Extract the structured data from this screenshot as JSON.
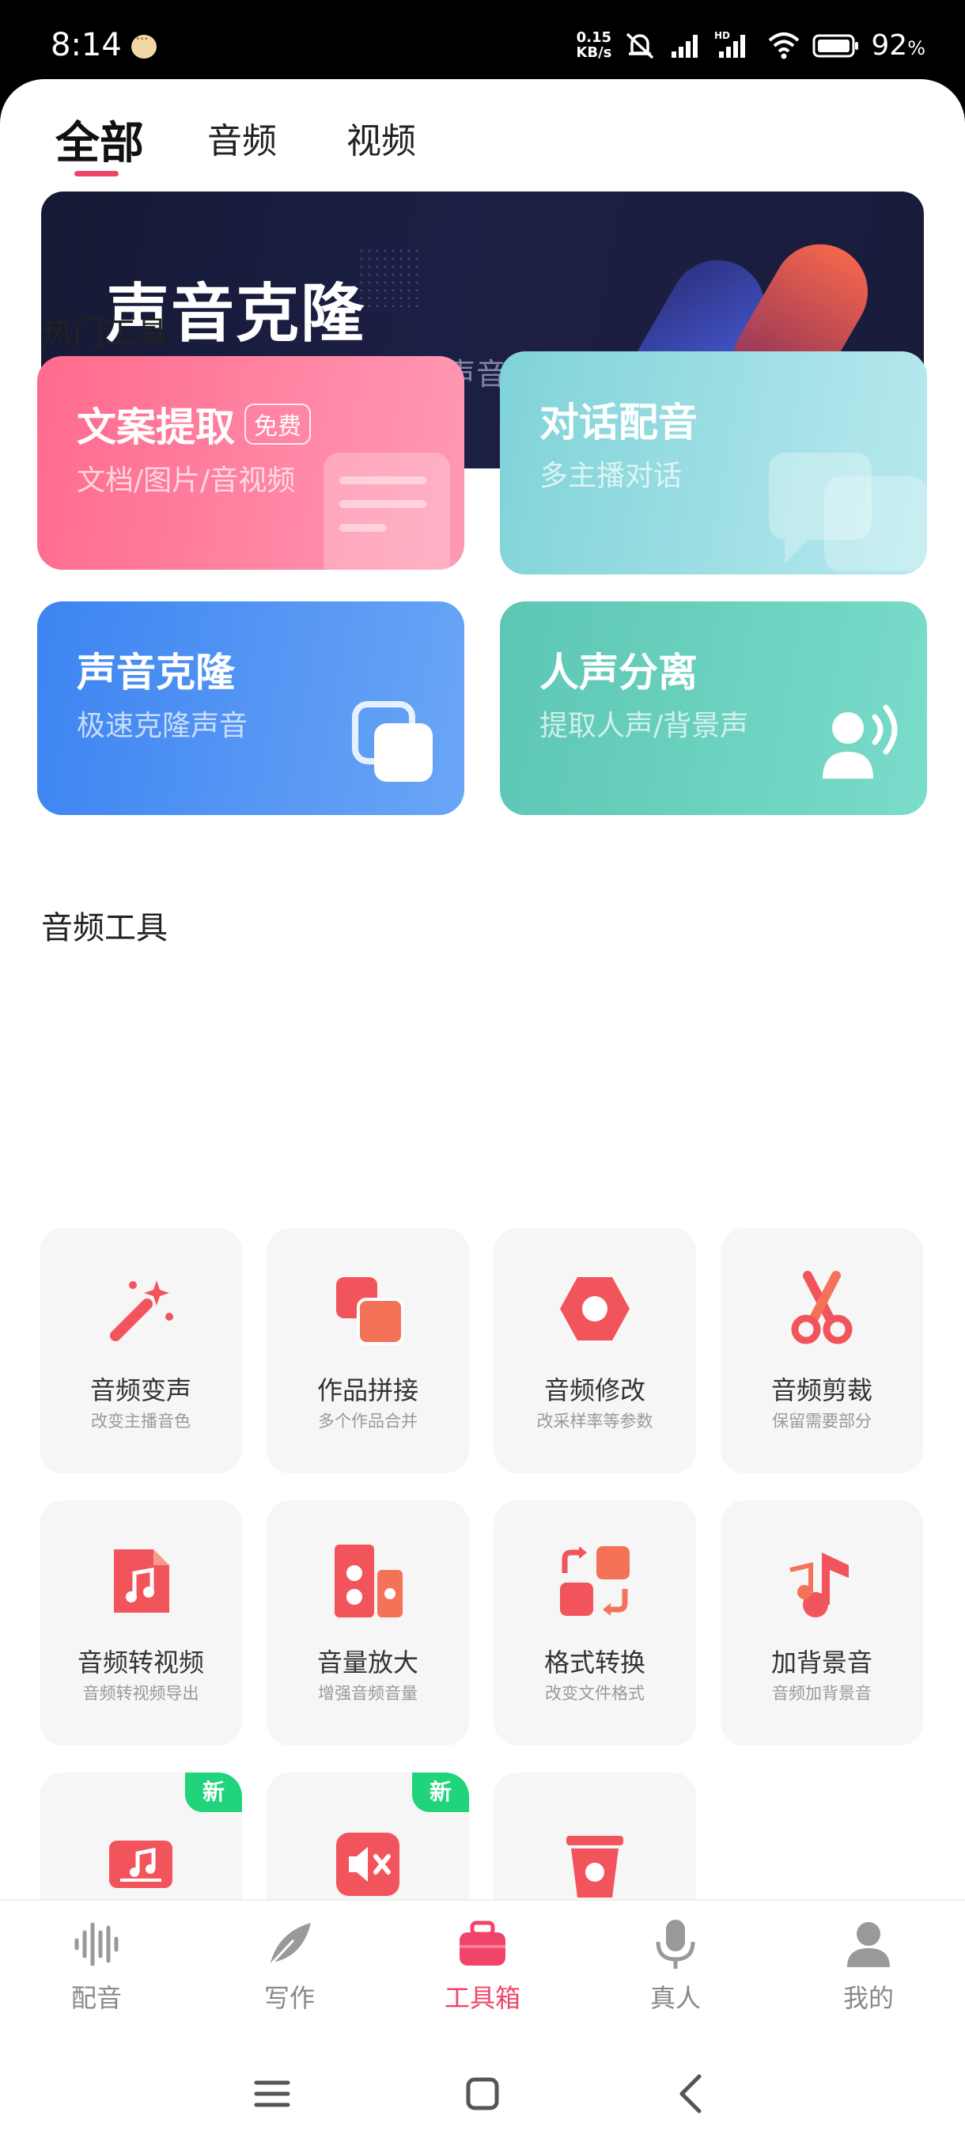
{
  "status_bar": {
    "time": "8:14",
    "speed_value": "0.15",
    "speed_unit": "KB/s",
    "hd_label": "HD",
    "battery_value": "92",
    "battery_unit": "%"
  },
  "tabs": [
    {
      "label": "全部",
      "active": true
    },
    {
      "label": "音频",
      "active": false
    },
    {
      "label": "视频",
      "active": false
    }
  ],
  "banner": {
    "title": "声音克隆",
    "subtitle": "告别繁琐配音，完美克隆声音"
  },
  "hot_tools": {
    "section_title": "热门工具",
    "items": [
      {
        "title": "文案提取",
        "badge": "免费",
        "subtitle": "文档/图片/音视频",
        "icon": "document-icon",
        "color_from": "#ff6b8d",
        "color_to": "#ff9ab3"
      },
      {
        "title": "对话配音",
        "subtitle": "多主播对话",
        "icon": "chat-bubbles-icon",
        "color_from": "#7fd4d9",
        "color_to": "#b7e8ee"
      },
      {
        "title": "声音克隆",
        "subtitle": "极速克隆声音",
        "icon": "copy-icon",
        "color_from": "#3d86f2",
        "color_to": "#6ba7f6"
      },
      {
        "title": "人声分离",
        "subtitle": "提取人声/背景声",
        "icon": "person-voice-icon",
        "color_from": "#5cc9b5",
        "color_to": "#78dbc7"
      }
    ]
  },
  "audio_tools": {
    "section_title": "音频工具",
    "items": [
      {
        "name": "音频变声",
        "desc": "改变主播音色",
        "icon": "magic-wand-icon"
      },
      {
        "name": "作品拼接",
        "desc": "多个作品合并",
        "icon": "merge-icon"
      },
      {
        "name": "音频修改",
        "desc": "改采样率等参数",
        "icon": "hexagon-settings-icon"
      },
      {
        "name": "音频剪裁",
        "desc": "保留需要部分",
        "icon": "scissors-icon"
      },
      {
        "name": "音频转视频",
        "desc": "音频转视频导出",
        "icon": "music-file-icon"
      },
      {
        "name": "音量放大",
        "desc": "增强音频音量",
        "icon": "speaker-icon"
      },
      {
        "name": "格式转换",
        "desc": "改变文件格式",
        "icon": "convert-icon"
      },
      {
        "name": "加背景音",
        "desc": "音频加背景音",
        "icon": "music-note-icon"
      },
      {
        "badge": "新",
        "icon": "music-screen-icon"
      },
      {
        "badge": "新",
        "icon": "mute-icon"
      },
      {
        "icon": "record-bucket-icon"
      }
    ]
  },
  "bottom_nav": [
    {
      "label": "配音",
      "icon": "waveform-icon",
      "active": false
    },
    {
      "label": "写作",
      "icon": "feather-icon",
      "active": false
    },
    {
      "label": "工具箱",
      "icon": "toolbox-icon",
      "active": true
    },
    {
      "label": "真人",
      "icon": "microphone-icon",
      "active": false
    },
    {
      "label": "我的",
      "icon": "profile-icon",
      "active": false
    }
  ],
  "colors": {
    "accent": "#f0446a",
    "tool_icon": "#f2545b",
    "new_badge": "#1fd47a"
  }
}
